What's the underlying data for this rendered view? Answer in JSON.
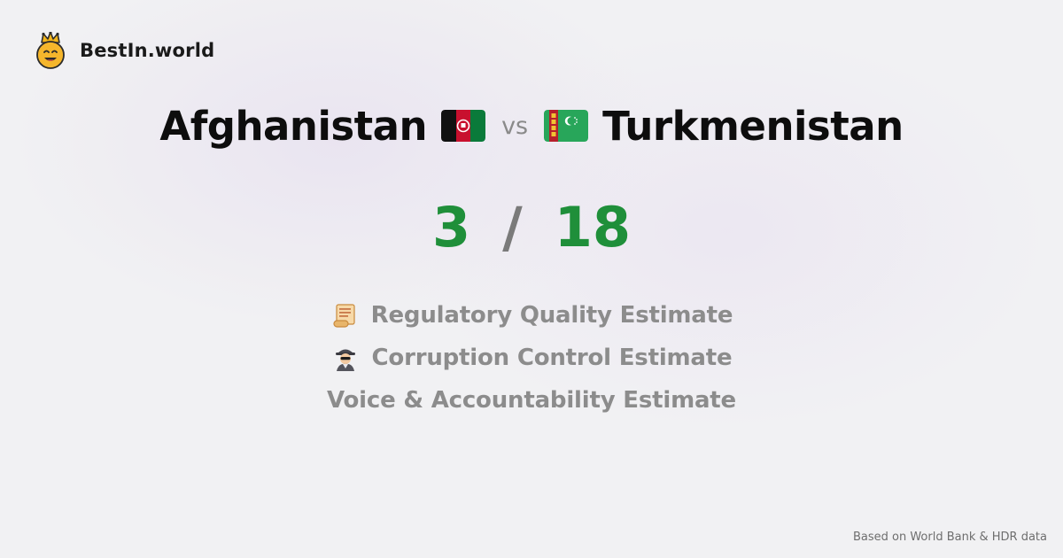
{
  "brand": {
    "name": "BestIn.world",
    "logo_icon": "crowned-smiley-icon"
  },
  "comparison": {
    "left_country": "Afghanistan",
    "left_flag_icon": "afghanistan-flag-icon",
    "vs_label": "vs",
    "right_country": "Turkmenistan",
    "right_flag_icon": "turkmenistan-flag-icon"
  },
  "score": {
    "left": "3",
    "separator": "/",
    "right": "18",
    "color": "#1f8f3a"
  },
  "metrics": [
    {
      "icon": "scroll-icon",
      "label": "Regulatory Quality Estimate"
    },
    {
      "icon": "detective-icon",
      "label": "Corruption Control Estimate"
    },
    {
      "icon": "",
      "label": "Voice & Accountability Estimate"
    }
  ],
  "footer": {
    "source": "Based on World Bank & HDR data"
  }
}
